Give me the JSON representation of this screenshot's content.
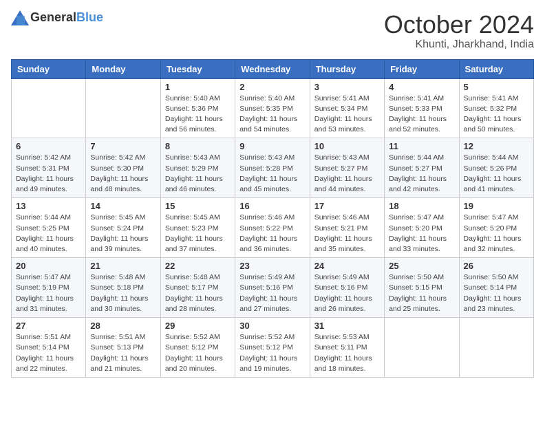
{
  "header": {
    "logo_general": "General",
    "logo_blue": "Blue",
    "month": "October 2024",
    "location": "Khunti, Jharkhand, India"
  },
  "weekdays": [
    "Sunday",
    "Monday",
    "Tuesday",
    "Wednesday",
    "Thursday",
    "Friday",
    "Saturday"
  ],
  "weeks": [
    [
      {
        "day": "",
        "sunrise": "",
        "sunset": "",
        "daylight": ""
      },
      {
        "day": "",
        "sunrise": "",
        "sunset": "",
        "daylight": ""
      },
      {
        "day": "1",
        "sunrise": "Sunrise: 5:40 AM",
        "sunset": "Sunset: 5:36 PM",
        "daylight": "Daylight: 11 hours and 56 minutes."
      },
      {
        "day": "2",
        "sunrise": "Sunrise: 5:40 AM",
        "sunset": "Sunset: 5:35 PM",
        "daylight": "Daylight: 11 hours and 54 minutes."
      },
      {
        "day": "3",
        "sunrise": "Sunrise: 5:41 AM",
        "sunset": "Sunset: 5:34 PM",
        "daylight": "Daylight: 11 hours and 53 minutes."
      },
      {
        "day": "4",
        "sunrise": "Sunrise: 5:41 AM",
        "sunset": "Sunset: 5:33 PM",
        "daylight": "Daylight: 11 hours and 52 minutes."
      },
      {
        "day": "5",
        "sunrise": "Sunrise: 5:41 AM",
        "sunset": "Sunset: 5:32 PM",
        "daylight": "Daylight: 11 hours and 50 minutes."
      }
    ],
    [
      {
        "day": "6",
        "sunrise": "Sunrise: 5:42 AM",
        "sunset": "Sunset: 5:31 PM",
        "daylight": "Daylight: 11 hours and 49 minutes."
      },
      {
        "day": "7",
        "sunrise": "Sunrise: 5:42 AM",
        "sunset": "Sunset: 5:30 PM",
        "daylight": "Daylight: 11 hours and 48 minutes."
      },
      {
        "day": "8",
        "sunrise": "Sunrise: 5:43 AM",
        "sunset": "Sunset: 5:29 PM",
        "daylight": "Daylight: 11 hours and 46 minutes."
      },
      {
        "day": "9",
        "sunrise": "Sunrise: 5:43 AM",
        "sunset": "Sunset: 5:28 PM",
        "daylight": "Daylight: 11 hours and 45 minutes."
      },
      {
        "day": "10",
        "sunrise": "Sunrise: 5:43 AM",
        "sunset": "Sunset: 5:27 PM",
        "daylight": "Daylight: 11 hours and 44 minutes."
      },
      {
        "day": "11",
        "sunrise": "Sunrise: 5:44 AM",
        "sunset": "Sunset: 5:27 PM",
        "daylight": "Daylight: 11 hours and 42 minutes."
      },
      {
        "day": "12",
        "sunrise": "Sunrise: 5:44 AM",
        "sunset": "Sunset: 5:26 PM",
        "daylight": "Daylight: 11 hours and 41 minutes."
      }
    ],
    [
      {
        "day": "13",
        "sunrise": "Sunrise: 5:44 AM",
        "sunset": "Sunset: 5:25 PM",
        "daylight": "Daylight: 11 hours and 40 minutes."
      },
      {
        "day": "14",
        "sunrise": "Sunrise: 5:45 AM",
        "sunset": "Sunset: 5:24 PM",
        "daylight": "Daylight: 11 hours and 39 minutes."
      },
      {
        "day": "15",
        "sunrise": "Sunrise: 5:45 AM",
        "sunset": "Sunset: 5:23 PM",
        "daylight": "Daylight: 11 hours and 37 minutes."
      },
      {
        "day": "16",
        "sunrise": "Sunrise: 5:46 AM",
        "sunset": "Sunset: 5:22 PM",
        "daylight": "Daylight: 11 hours and 36 minutes."
      },
      {
        "day": "17",
        "sunrise": "Sunrise: 5:46 AM",
        "sunset": "Sunset: 5:21 PM",
        "daylight": "Daylight: 11 hours and 35 minutes."
      },
      {
        "day": "18",
        "sunrise": "Sunrise: 5:47 AM",
        "sunset": "Sunset: 5:20 PM",
        "daylight": "Daylight: 11 hours and 33 minutes."
      },
      {
        "day": "19",
        "sunrise": "Sunrise: 5:47 AM",
        "sunset": "Sunset: 5:20 PM",
        "daylight": "Daylight: 11 hours and 32 minutes."
      }
    ],
    [
      {
        "day": "20",
        "sunrise": "Sunrise: 5:47 AM",
        "sunset": "Sunset: 5:19 PM",
        "daylight": "Daylight: 11 hours and 31 minutes."
      },
      {
        "day": "21",
        "sunrise": "Sunrise: 5:48 AM",
        "sunset": "Sunset: 5:18 PM",
        "daylight": "Daylight: 11 hours and 30 minutes."
      },
      {
        "day": "22",
        "sunrise": "Sunrise: 5:48 AM",
        "sunset": "Sunset: 5:17 PM",
        "daylight": "Daylight: 11 hours and 28 minutes."
      },
      {
        "day": "23",
        "sunrise": "Sunrise: 5:49 AM",
        "sunset": "Sunset: 5:16 PM",
        "daylight": "Daylight: 11 hours and 27 minutes."
      },
      {
        "day": "24",
        "sunrise": "Sunrise: 5:49 AM",
        "sunset": "Sunset: 5:16 PM",
        "daylight": "Daylight: 11 hours and 26 minutes."
      },
      {
        "day": "25",
        "sunrise": "Sunrise: 5:50 AM",
        "sunset": "Sunset: 5:15 PM",
        "daylight": "Daylight: 11 hours and 25 minutes."
      },
      {
        "day": "26",
        "sunrise": "Sunrise: 5:50 AM",
        "sunset": "Sunset: 5:14 PM",
        "daylight": "Daylight: 11 hours and 23 minutes."
      }
    ],
    [
      {
        "day": "27",
        "sunrise": "Sunrise: 5:51 AM",
        "sunset": "Sunset: 5:14 PM",
        "daylight": "Daylight: 11 hours and 22 minutes."
      },
      {
        "day": "28",
        "sunrise": "Sunrise: 5:51 AM",
        "sunset": "Sunset: 5:13 PM",
        "daylight": "Daylight: 11 hours and 21 minutes."
      },
      {
        "day": "29",
        "sunrise": "Sunrise: 5:52 AM",
        "sunset": "Sunset: 5:12 PM",
        "daylight": "Daylight: 11 hours and 20 minutes."
      },
      {
        "day": "30",
        "sunrise": "Sunrise: 5:52 AM",
        "sunset": "Sunset: 5:12 PM",
        "daylight": "Daylight: 11 hours and 19 minutes."
      },
      {
        "day": "31",
        "sunrise": "Sunrise: 5:53 AM",
        "sunset": "Sunset: 5:11 PM",
        "daylight": "Daylight: 11 hours and 18 minutes."
      },
      {
        "day": "",
        "sunrise": "",
        "sunset": "",
        "daylight": ""
      },
      {
        "day": "",
        "sunrise": "",
        "sunset": "",
        "daylight": ""
      }
    ]
  ]
}
